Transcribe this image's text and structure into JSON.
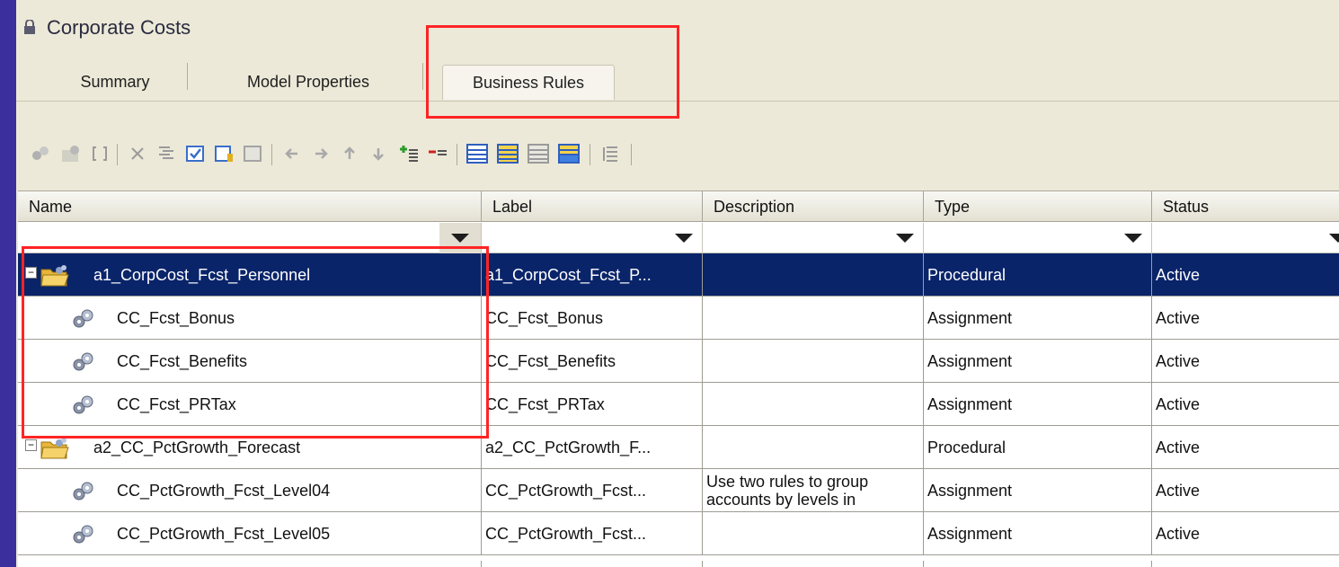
{
  "window": {
    "title": "Corporate Costs"
  },
  "tabs": [
    {
      "label": "Summary"
    },
    {
      "label": "Model Properties"
    },
    {
      "label": "Business Rules"
    }
  ],
  "grid": {
    "columns": [
      {
        "label": "Name"
      },
      {
        "label": "Label"
      },
      {
        "label": "Description"
      },
      {
        "label": "Type"
      },
      {
        "label": "Status"
      }
    ],
    "rows": [
      {
        "kind": "group",
        "name": "a1_CorpCost_Fcst_Personnel",
        "label": "a1_CorpCost_Fcst_P...",
        "description": "",
        "type": "Procedural",
        "status": "Active",
        "selected": true
      },
      {
        "kind": "rule",
        "name": "CC_Fcst_Bonus",
        "label": "CC_Fcst_Bonus",
        "description": "",
        "type": "Assignment",
        "status": "Active"
      },
      {
        "kind": "rule",
        "name": "CC_Fcst_Benefits",
        "label": "CC_Fcst_Benefits",
        "description": "",
        "type": "Assignment",
        "status": "Active"
      },
      {
        "kind": "rule",
        "name": "CC_Fcst_PRTax",
        "label": "CC_Fcst_PRTax",
        "description": "",
        "type": "Assignment",
        "status": "Active"
      },
      {
        "kind": "group",
        "name": "a2_CC_PctGrowth_Forecast",
        "label": "a2_CC_PctGrowth_F...",
        "description": "",
        "type": "Procedural",
        "status": "Active"
      },
      {
        "kind": "rule",
        "name": "CC_PctGrowth_Fcst_Level04",
        "label": "CC_PctGrowth_Fcst...",
        "description": "Use two rules to group accounts by levels in",
        "type": "Assignment",
        "status": "Active"
      },
      {
        "kind": "rule",
        "name": "CC_PctGrowth_Fcst_Level05",
        "label": "CC_PctGrowth_Fcst...",
        "description": "",
        "type": "Assignment",
        "status": "Active"
      }
    ]
  },
  "colors": {
    "selection": "#0a246a",
    "highlight": "#ff2424"
  }
}
